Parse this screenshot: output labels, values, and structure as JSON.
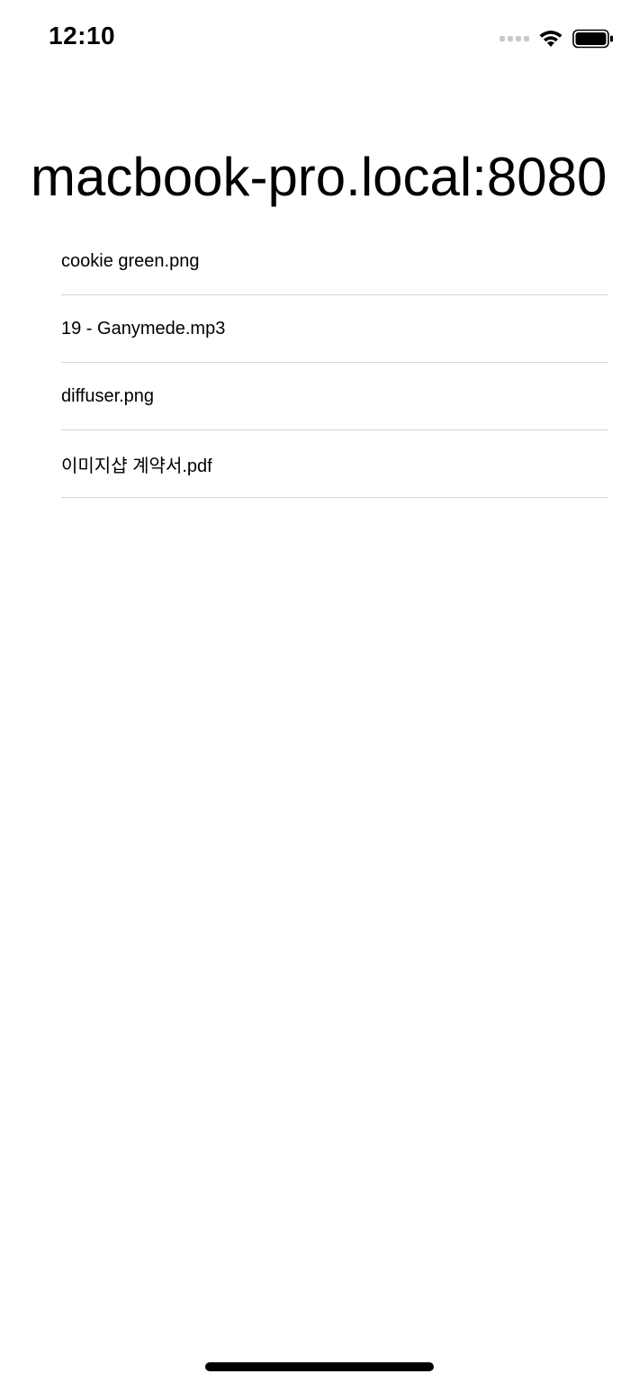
{
  "status_bar": {
    "time": "12:10",
    "signal_icon": "cellular-signal-icon",
    "wifi_icon": "wifi-icon",
    "battery_icon": "battery-full-icon"
  },
  "page": {
    "title": "macbook-pro.local:8080"
  },
  "files": [
    {
      "name": "cookie green.png"
    },
    {
      "name": "19 - Ganymede.mp3"
    },
    {
      "name": "diffuser.png"
    },
    {
      "name": "이미지샵 계약서.pdf"
    }
  ]
}
